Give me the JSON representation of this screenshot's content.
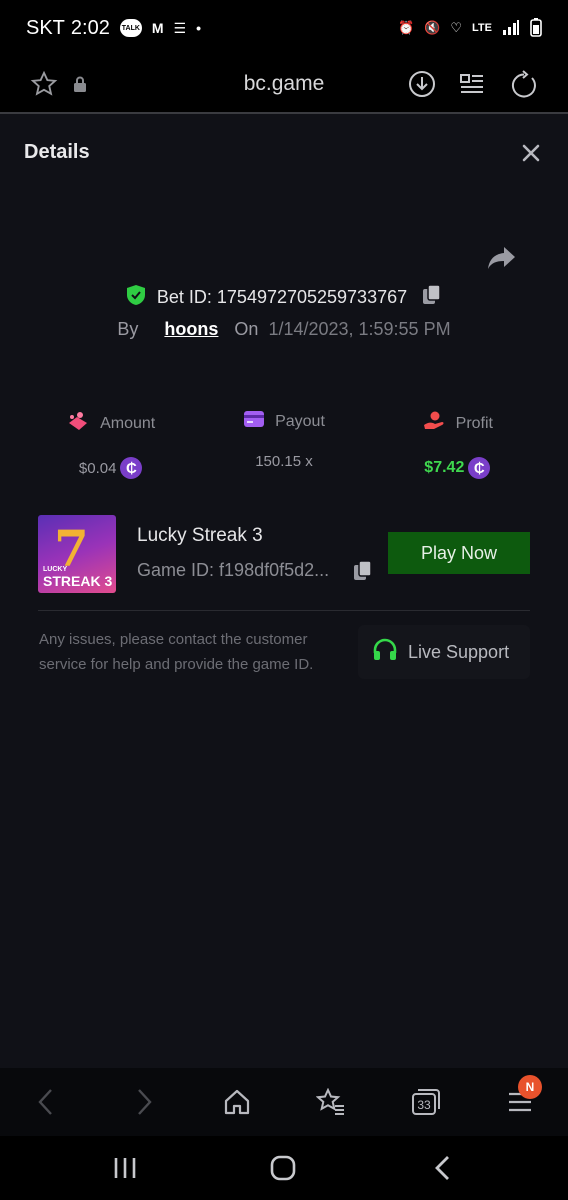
{
  "status_bar": {
    "carrier": "SKT",
    "time": "2:02",
    "network": "LTE"
  },
  "browser": {
    "url": "bc.game"
  },
  "details": {
    "title": "Details",
    "bet_id_label": "Bet ID:",
    "bet_id": "1754972705259733767",
    "by_label": "By",
    "username": "hoons",
    "on_label": "On",
    "date": "1/14/2023, 1:59:55 PM",
    "stats": [
      {
        "label": "Amount",
        "value": "$0.04",
        "icon": "amount-icon"
      },
      {
        "label": "Payout",
        "value": "150.15 x",
        "icon": "payout-card-icon"
      },
      {
        "label": "Profit",
        "value": "$7.42",
        "icon": "profit-icon"
      }
    ],
    "coin_symbol": "₵",
    "game": {
      "name": "Lucky Streak 3",
      "id_label": "Game ID:",
      "id": "f198df0f5d2...",
      "thumb_text_small": "LUCKY",
      "thumb_text_big": "STREAK 3",
      "play_label": "Play Now"
    },
    "help_text": "Any issues, please contact the customer service for help and provide the game ID.",
    "live_support_label": "Live Support"
  },
  "bottom_nav": {
    "tab_count": "33",
    "badge": "N"
  },
  "colors": {
    "profit": "#3fd84f",
    "play_button": "#0d5a0e",
    "coin": "#7a3ec9",
    "shield": "#2fcc43"
  }
}
